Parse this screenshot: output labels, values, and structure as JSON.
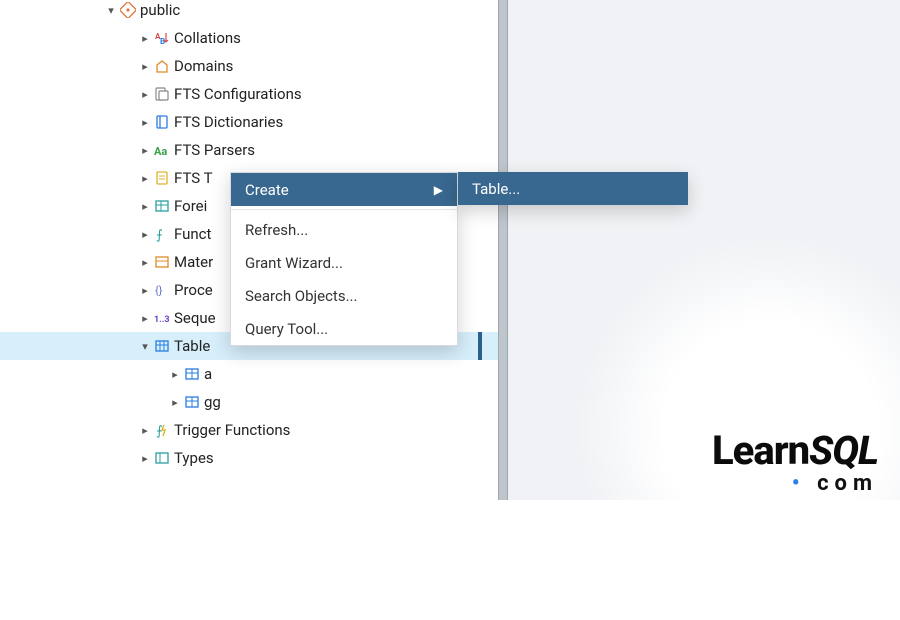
{
  "tree": {
    "schema": "public",
    "items": {
      "collations": "Collations",
      "domains": "Domains",
      "fts_configs": "FTS Configurations",
      "fts_dicts": "FTS Dictionaries",
      "fts_parsers": "FTS Parsers",
      "fts_templates_trunc": "FTS T",
      "foreign_trunc": "Forei",
      "functions_trunc": "Funct",
      "materialized_trunc": "Mater",
      "procedures_trunc": "Proce",
      "sequences_trunc": "Seque",
      "tables_trunc": "Table",
      "table_a": "a",
      "table_gg": "gg",
      "trigger_functions": "Trigger Functions",
      "types": "Types"
    }
  },
  "context_menu": {
    "create": "Create",
    "refresh": "Refresh...",
    "grant_wizard": "Grant Wizard...",
    "search_objects": "Search Objects...",
    "query_tool": "Query Tool..."
  },
  "submenu": {
    "table": "Table..."
  },
  "logo": {
    "brand_a": "Learn",
    "brand_b": "SQL",
    "suffix": "com"
  },
  "colors": {
    "menu_highlight": "#38678f",
    "row_highlight": "#d7eefb",
    "divider": "#bfc5cc"
  }
}
